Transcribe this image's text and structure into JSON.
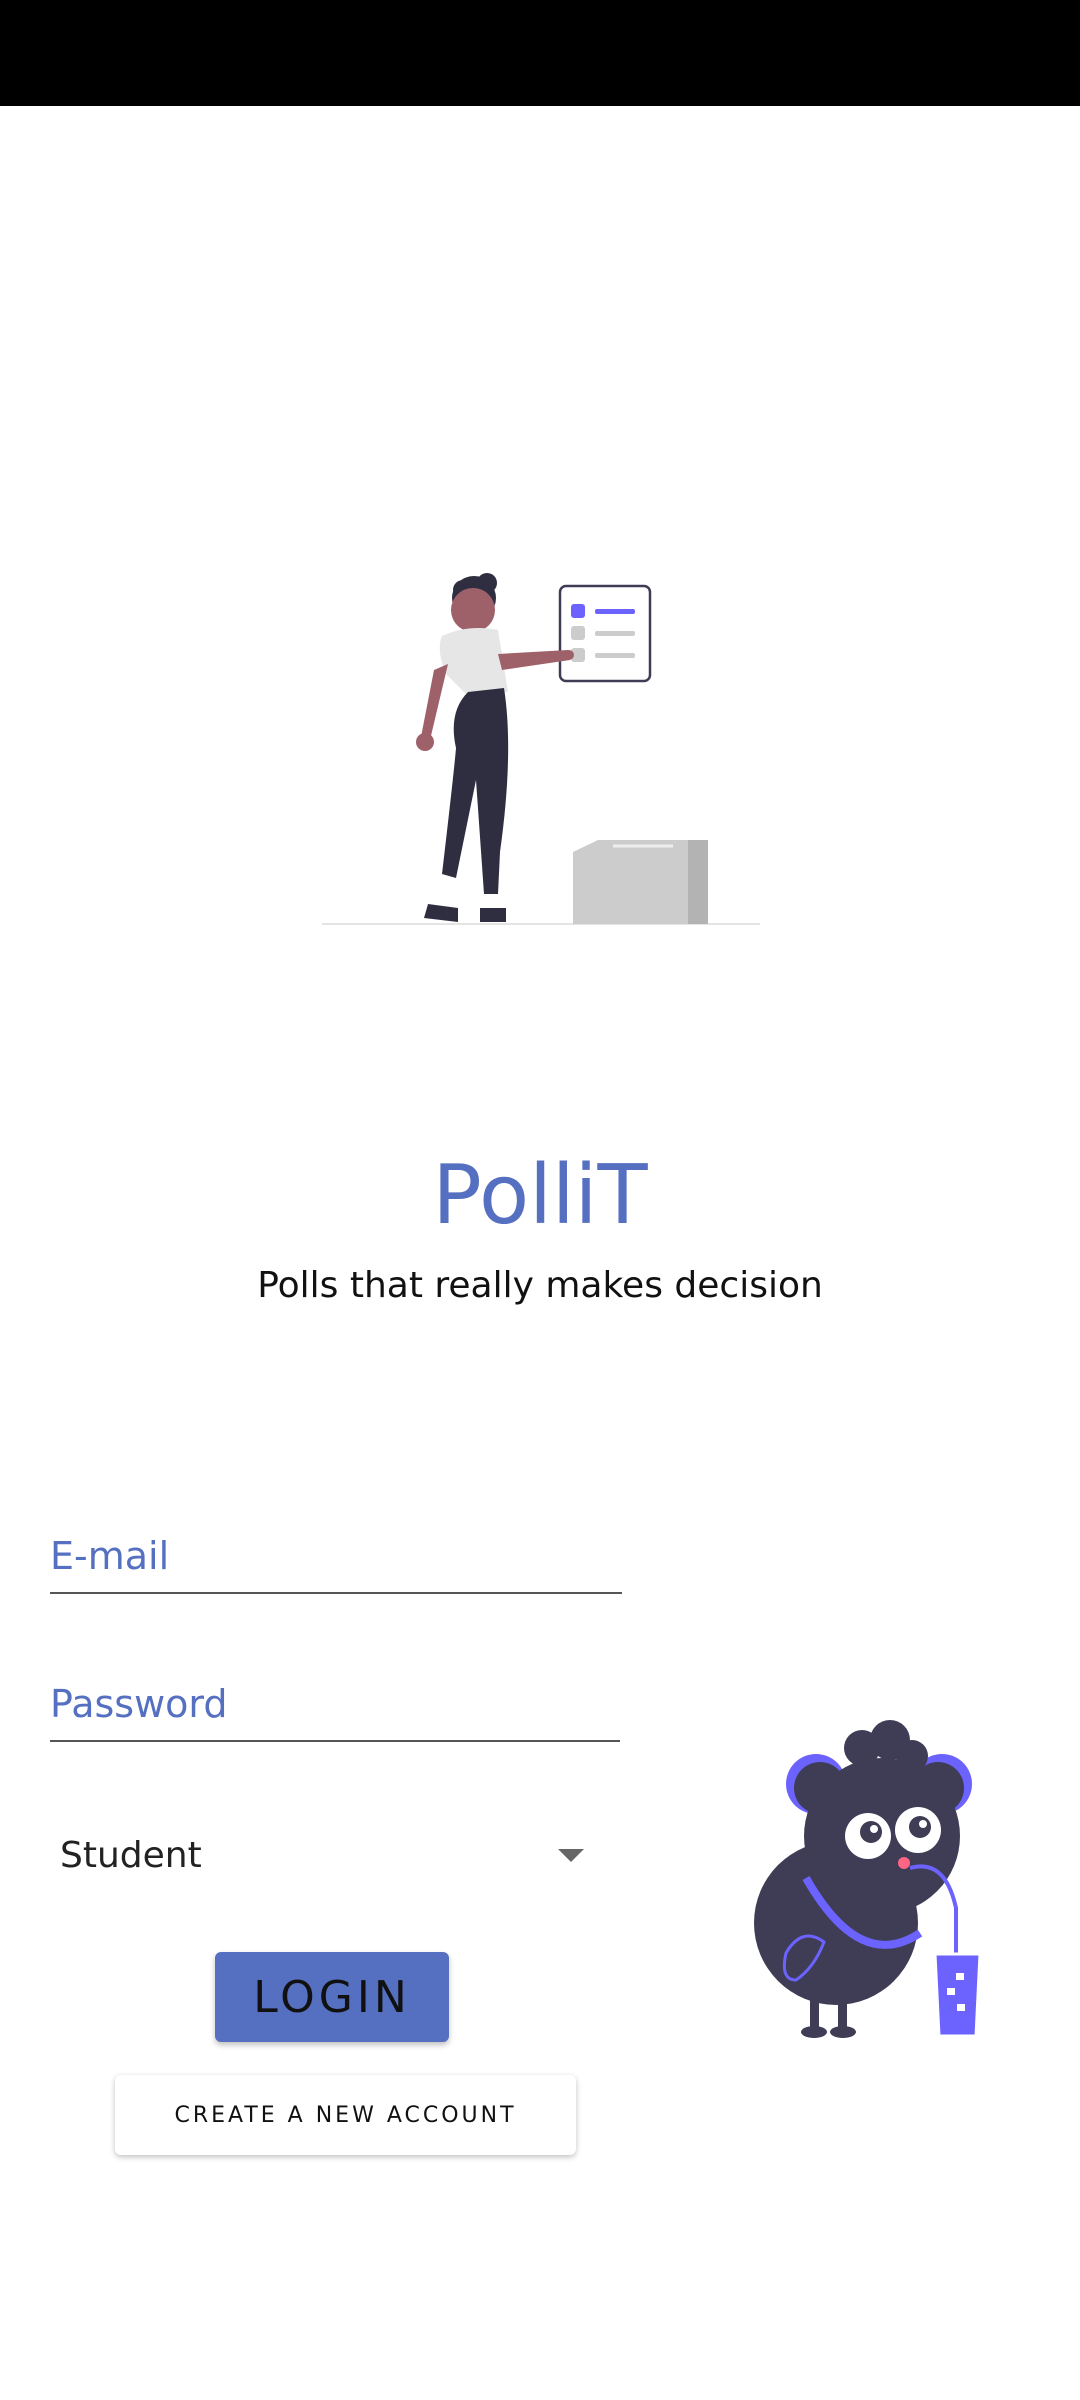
{
  "app": {
    "title": "PolliT",
    "tagline": "Polls that really makes decision"
  },
  "form": {
    "email_placeholder": "E-mail",
    "password_placeholder": "Password",
    "role_selected": "Student",
    "login_label": "LOGIN",
    "create_account_label": "CREATE A NEW ACCOUNT"
  },
  "icons": {
    "role_dropdown": "dropdown-arrow-icon"
  },
  "colors": {
    "accent": "#5570c0",
    "illustration_purple": "#6c63ff",
    "illustration_dark": "#2f2e41"
  }
}
